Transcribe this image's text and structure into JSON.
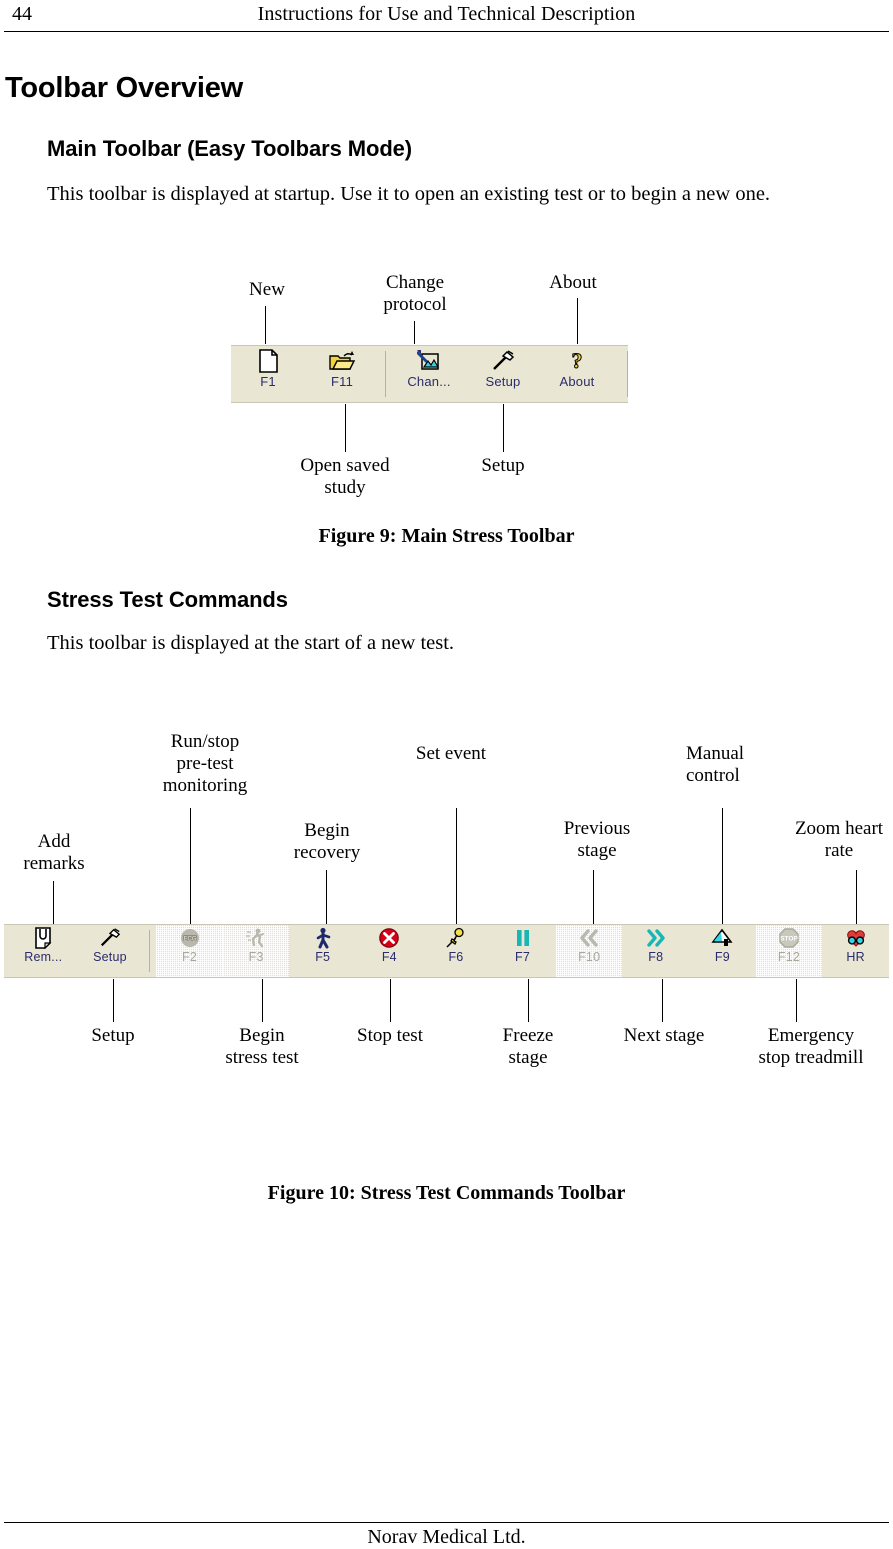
{
  "header": {
    "page_number": "44",
    "title": "Instructions for Use and Technical Description"
  },
  "footer": {
    "company": "Norav Medical Ltd."
  },
  "sections": {
    "h1": "Toolbar Overview",
    "main_toolbar": {
      "heading": "Main Toolbar (Easy Toolbars Mode)",
      "paragraph": "This toolbar is displayed at startup. Use it to open an existing test or to begin a new one.",
      "caption": "Figure 9: Main Stress Toolbar"
    },
    "stress_commands": {
      "heading": "Stress Test Commands",
      "paragraph": "This toolbar is displayed at the start of a new test.",
      "caption": "Figure 10: Stress Test Commands Toolbar"
    }
  },
  "figure9": {
    "toolbar_background": "#e9e6d4",
    "buttons": [
      {
        "key": "F1",
        "icon": "new-document-icon",
        "enabled": true
      },
      {
        "key": "F11",
        "icon": "open-folder-icon",
        "enabled": true
      },
      {
        "key": "Chan...",
        "icon": "change-protocol-icon",
        "enabled": true
      },
      {
        "key": "Setup",
        "icon": "hammer-setup-icon",
        "enabled": true
      },
      {
        "key": "About",
        "icon": "question-help-icon",
        "enabled": true
      }
    ],
    "callouts_top": [
      {
        "label": "New"
      },
      {
        "label": "Change\nprotocol"
      },
      {
        "label": "About"
      }
    ],
    "callouts_bottom": [
      {
        "label": "Open saved\nstudy"
      },
      {
        "label": "Setup"
      }
    ]
  },
  "figure10": {
    "toolbar_background": "#e9e6d4",
    "buttons": [
      {
        "key": "Rem...",
        "icon": "remarks-note-icon",
        "enabled": true
      },
      {
        "key": "Setup",
        "icon": "hammer-setup-icon",
        "enabled": true
      },
      {
        "key": "F2",
        "icon": "ecg-monitor-icon",
        "enabled": false
      },
      {
        "key": "F3",
        "icon": "running-person-icon",
        "enabled": false
      },
      {
        "key": "F5",
        "icon": "walking-person-icon",
        "enabled": true
      },
      {
        "key": "F4",
        "icon": "red-x-stop-icon",
        "enabled": true
      },
      {
        "key": "F6",
        "icon": "yellow-pushpin-icon",
        "enabled": true
      },
      {
        "key": "F7",
        "icon": "pause-bars-icon",
        "enabled": true
      },
      {
        "key": "F10",
        "icon": "double-chevron-left-icon",
        "enabled": false
      },
      {
        "key": "F8",
        "icon": "double-chevron-right-icon",
        "enabled": true
      },
      {
        "key": "F9",
        "icon": "manual-control-icon",
        "enabled": true
      },
      {
        "key": "F12",
        "icon": "stop-sign-icon",
        "enabled": false
      },
      {
        "key": "HR",
        "icon": "heart-zoom-icon",
        "enabled": true
      }
    ],
    "callouts_top": [
      {
        "label": "Add\nremarks"
      },
      {
        "label": "Run/stop\npre-test\nmonitoring"
      },
      {
        "label": "Begin\nrecovery"
      },
      {
        "label": "Set event"
      },
      {
        "label": "Previous\nstage"
      },
      {
        "label": "Manual\ncontrol"
      },
      {
        "label": "Zoom heart\nrate"
      }
    ],
    "callouts_bottom": [
      {
        "label": "Setup"
      },
      {
        "label": "Begin\nstress test"
      },
      {
        "label": "Stop test"
      },
      {
        "label": "Freeze\nstage"
      },
      {
        "label": "Next stage"
      },
      {
        "label": "Emergency\nstop treadmill"
      }
    ]
  }
}
